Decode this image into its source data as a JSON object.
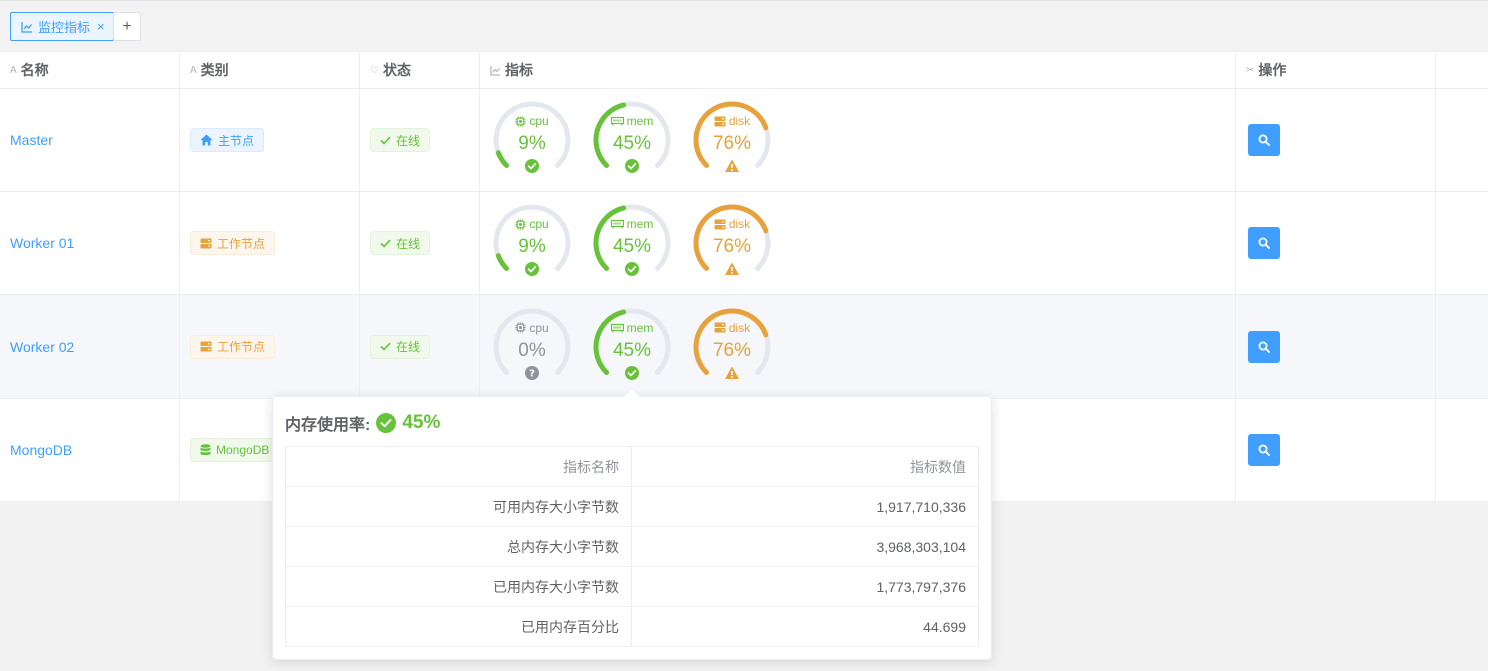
{
  "tab": {
    "label": "监控指标",
    "close": "×",
    "add": "+"
  },
  "columns": {
    "name": "名称",
    "type": "类别",
    "status": "状态",
    "metrics": "指标",
    "actions": "操作"
  },
  "colors": {
    "primary": "#409eff",
    "success": "#67c23a",
    "warning": "#e6a23c",
    "muted": "#909399",
    "track": "#e4e7ed"
  },
  "rows": [
    {
      "name": "Master",
      "type": "主节点",
      "type_style": "primary",
      "type_icon": "home-icon",
      "status": "在线",
      "gauges": [
        {
          "label": "cpu",
          "value": "9%",
          "percent": 9,
          "state": "ok"
        },
        {
          "label": "mem",
          "value": "45%",
          "percent": 45,
          "state": "ok"
        },
        {
          "label": "disk",
          "value": "76%",
          "percent": 76,
          "state": "warning"
        }
      ]
    },
    {
      "name": "Worker 01",
      "type": "工作节点",
      "type_style": "warning",
      "type_icon": "server-icon",
      "status": "在线",
      "gauges": [
        {
          "label": "cpu",
          "value": "9%",
          "percent": 9,
          "state": "ok"
        },
        {
          "label": "mem",
          "value": "45%",
          "percent": 45,
          "state": "ok"
        },
        {
          "label": "disk",
          "value": "76%",
          "percent": 76,
          "state": "warning"
        }
      ]
    },
    {
      "name": "Worker 02",
      "type": "工作节点",
      "type_style": "warning",
      "type_icon": "server-icon",
      "status": "在线",
      "gauges": [
        {
          "label": "cpu",
          "value": "0%",
          "percent": 0,
          "state": "unknown"
        },
        {
          "label": "mem",
          "value": "45%",
          "percent": 45,
          "state": "ok"
        },
        {
          "label": "disk",
          "value": "76%",
          "percent": 76,
          "state": "warning"
        }
      ]
    },
    {
      "name": "MongoDB",
      "type": "MongoDB",
      "type_style": "success",
      "type_icon": "database-icon",
      "status": "",
      "gauges": []
    }
  ],
  "popover": {
    "title": "内存使用率:",
    "value": "45%",
    "headers": {
      "key": "指标名称",
      "val": "指标数值"
    },
    "items": [
      {
        "key": "可用内存大小字节数",
        "val": "1,917,710,336"
      },
      {
        "key": "总内存大小字节数",
        "val": "3,968,303,104"
      },
      {
        "key": "已用内存大小字节数",
        "val": "1,773,797,376"
      },
      {
        "key": "已用内存百分比",
        "val": "44.699"
      }
    ]
  }
}
